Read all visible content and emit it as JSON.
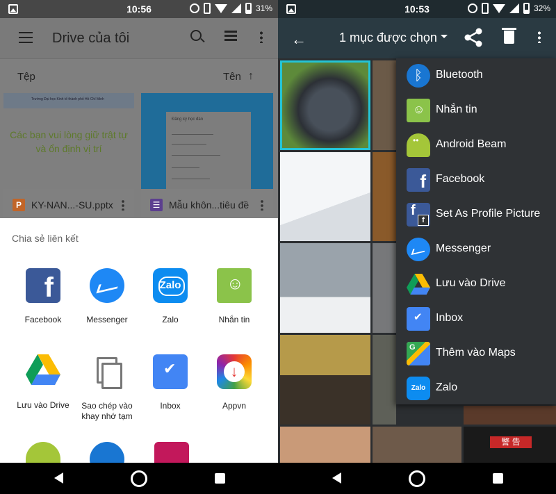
{
  "left": {
    "status": {
      "time": "10:56",
      "battery": "31%"
    },
    "toolbar": {
      "title": "Drive của tôi"
    },
    "sortbar": {
      "left_label": "Tệp",
      "right_label": "Tên"
    },
    "files": [
      {
        "name": "KY-NAN...-SU.pptx",
        "type_icon": "P",
        "thumb_banner": "Trường Đại học Kinh tế thành phố Hồ Chí Minh",
        "thumb_text_1": "Các bạn vui lòng giữ trật tự",
        "thumb_text_2": "và ổn định vị trí"
      },
      {
        "name": "Mẫu khôn...tiêu đề",
        "type_icon": "☰",
        "thumb_title": "Đăng ký học đàn"
      }
    ],
    "sheet": {
      "title": "Chia sẻ liên kết",
      "items": [
        {
          "label": "Facebook",
          "icon": "facebook-icon"
        },
        {
          "label": "Messenger",
          "icon": "messenger-icon"
        },
        {
          "label": "Zalo",
          "icon": "zalo-icon",
          "icon_text": "Zalo"
        },
        {
          "label": "Nhắn tin",
          "icon": "messaging-icon"
        },
        {
          "label": "Lưu vào Drive",
          "icon": "drive-icon"
        },
        {
          "label_1": "Sao chép vào",
          "label_2": "khay nhớ tạm",
          "icon": "copy-icon"
        },
        {
          "label": "Inbox",
          "icon": "inbox-icon"
        },
        {
          "label": "Appvn",
          "icon": "appvn-icon"
        }
      ]
    }
  },
  "right": {
    "status": {
      "time": "10:53",
      "battery": "32%"
    },
    "toolbar": {
      "title": "1 mục được chọn"
    },
    "menu": [
      {
        "label": "Bluetooth",
        "icon": "bluetooth-icon"
      },
      {
        "label": "Nhắn tin",
        "icon": "messaging-icon"
      },
      {
        "label": "Android Beam",
        "icon": "android-icon"
      },
      {
        "label": "Facebook",
        "icon": "facebook-icon"
      },
      {
        "label": "Set As Profile Picture",
        "icon": "facebook-profile-icon"
      },
      {
        "label": "Messenger",
        "icon": "messenger-icon"
      },
      {
        "label": "Lưu vào Drive",
        "icon": "drive-icon"
      },
      {
        "label": "Inbox",
        "icon": "inbox-icon"
      },
      {
        "label": "Thêm vào Maps",
        "icon": "maps-icon"
      },
      {
        "label": "Zalo",
        "icon": "zalo-icon",
        "icon_text": "Zalo"
      }
    ],
    "warning_sign": "警 告"
  },
  "colors": {
    "facebook": "#3b5998",
    "messenger": "#1e88f5",
    "zalo": "#0d8cf0",
    "sms": "#8bc34a",
    "selection": "#24c4d6"
  }
}
